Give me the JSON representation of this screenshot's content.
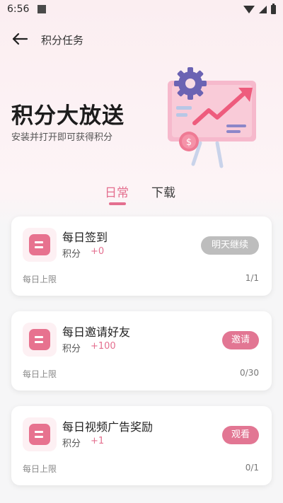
{
  "status_bar": {
    "time": "6:56"
  },
  "header": {
    "title": "积分任务"
  },
  "hero": {
    "title": "积分大放送",
    "subtitle": "安装并打开即可获得积分"
  },
  "tabs": [
    {
      "label": "日常",
      "active": true
    },
    {
      "label": "下载",
      "active": false
    }
  ],
  "tasks": [
    {
      "title": "每日签到",
      "points_label": "积分",
      "points": "+0",
      "button": "明天继续",
      "button_state": "disabled",
      "limit_label": "每日上限",
      "limit": "1/1"
    },
    {
      "title": "每日邀请好友",
      "points_label": "积分",
      "points": "+100",
      "button": "邀请",
      "button_state": "active",
      "limit_label": "每日上限",
      "limit": "0/30"
    },
    {
      "title": "每日视频广告奖励",
      "points_label": "积分",
      "points": "+1",
      "button": "观看",
      "button_state": "active",
      "limit_label": "每日上限",
      "limit": "0/1"
    }
  ],
  "colors": {
    "accent": "#e46f8f",
    "button_primary": "#e27693",
    "button_disabled": "#bdbdbd"
  },
  "icons": [
    "back-arrow-icon",
    "wifi-icon",
    "signal-icon",
    "battery-icon",
    "task-icon"
  ]
}
